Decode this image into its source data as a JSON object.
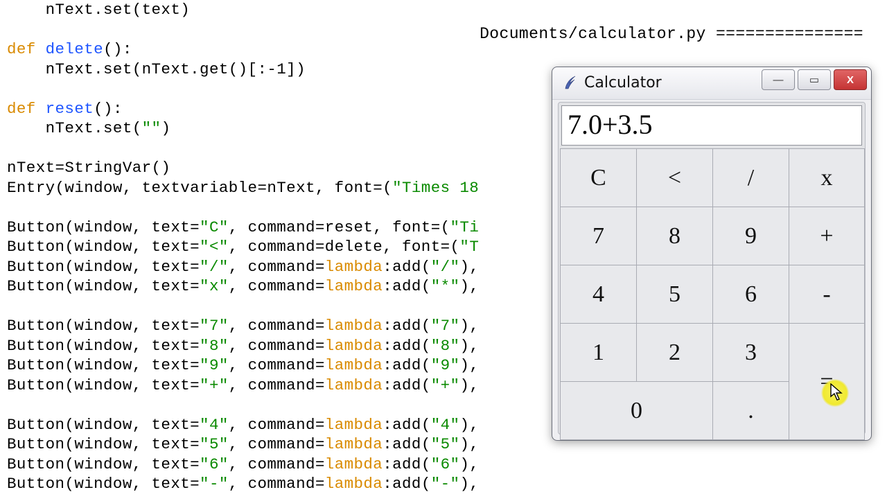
{
  "right_header": "Documents/calculator.py ===============",
  "code": {
    "l1a": "    nText.set(text)",
    "l3_def": "def",
    "l3_fn": "delete",
    "l3_rest": "():",
    "l4": "    nText.set(nText.get()[:-1])",
    "l6_def": "def",
    "l6_fn": "reset",
    "l6_rest": "():",
    "l7a": "    nText.set(",
    "l7s": "\"\"",
    "l7b": ")",
    "l9": "nText=StringVar()",
    "l10a": "Entry(window, textvariable=nText, font=(",
    "l10s": "\"Times 18",
    "l12a": "Button(window, text=",
    "l12s": "\"C\"",
    "l12b": ", command=reset, font=(",
    "l12s2": "\"Ti",
    "l13a": "Button(window, text=",
    "l13s": "\"<\"",
    "l13b": ", command=delete, font=(",
    "l13s2": "\"T",
    "l14a": "Button(window, text=",
    "l14s": "\"/\"",
    "l14b": ", command=",
    "l14lam": "lambda",
    "l14c": ":add(",
    "l14s2": "\"/\"",
    "l14d": "),",
    "l15a": "Button(window, text=",
    "l15s": "\"x\"",
    "l15b": ", command=",
    "l15lam": "lambda",
    "l15c": ":add(",
    "l15s2": "\"*\"",
    "l15d": "),",
    "l17a": "Button(window, text=",
    "l17s": "\"7\"",
    "l17b": ", command=",
    "l17lam": "lambda",
    "l17c": ":add(",
    "l17s2": "\"7\"",
    "l17d": "),",
    "l18a": "Button(window, text=",
    "l18s": "\"8\"",
    "l18b": ", command=",
    "l18lam": "lambda",
    "l18c": ":add(",
    "l18s2": "\"8\"",
    "l18d": "),",
    "l19a": "Button(window, text=",
    "l19s": "\"9\"",
    "l19b": ", command=",
    "l19lam": "lambda",
    "l19c": ":add(",
    "l19s2": "\"9\"",
    "l19d": "),",
    "l20a": "Button(window, text=",
    "l20s": "\"+\"",
    "l20b": ", command=",
    "l20lam": "lambda",
    "l20c": ":add(",
    "l20s2": "\"+\"",
    "l20d": "),",
    "l22a": "Button(window, text=",
    "l22s": "\"4\"",
    "l22b": ", command=",
    "l22lam": "lambda",
    "l22c": ":add(",
    "l22s2": "\"4\"",
    "l22d": "),",
    "l23a": "Button(window, text=",
    "l23s": "\"5\"",
    "l23b": ", command=",
    "l23lam": "lambda",
    "l23c": ":add(",
    "l23s2": "\"5\"",
    "l23d": "),",
    "l24a": "Button(window, text=",
    "l24s": "\"6\"",
    "l24b": ", command=",
    "l24lam": "lambda",
    "l24c": ":add(",
    "l24s2": "\"6\"",
    "l24d": "),",
    "l25a": "Button(window, text=",
    "l25s": "\"-\"",
    "l25b": ", command=",
    "l25lam": "lambda",
    "l25c": ":add(",
    "l25s2": "\"-\"",
    "l25d": "),"
  },
  "calc": {
    "title": "Calculator",
    "display_value": "7.0+3.5",
    "buttons": {
      "c": "C",
      "back": "<",
      "div": "/",
      "mul": "x",
      "7": "7",
      "8": "8",
      "9": "9",
      "add": "+",
      "4": "4",
      "5": "5",
      "6": "6",
      "sub": "-",
      "1": "1",
      "2": "2",
      "3": "3",
      "eq": "=",
      "0": "0",
      "dot": "."
    },
    "winbtn": {
      "min": "—",
      "max": "▭",
      "close": "X"
    }
  }
}
